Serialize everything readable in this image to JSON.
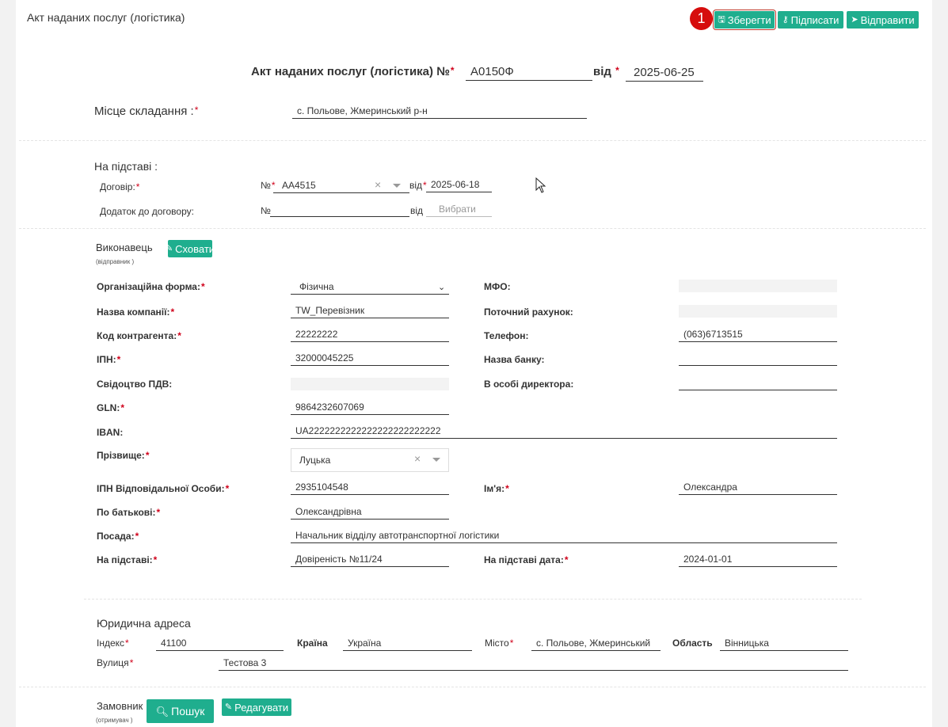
{
  "header": {
    "title": "Акт наданих послуг (логістика)",
    "step_badge": "1",
    "save_label": "Зберегти",
    "sign_label": "Підписати",
    "send_label": "Відправити"
  },
  "doc": {
    "title": "Акт наданих послуг (логістика) №",
    "number": "А0150Ф",
    "date_prefix": "від",
    "date": "2025-06-25"
  },
  "place": {
    "label": "Місце складання :",
    "value": "с. Польове, Жмеринський р-н"
  },
  "basis": {
    "heading": "На підставі :",
    "contract_label": "Договір:",
    "no_label": "№",
    "contract_number": "АА4515",
    "from_label": "від",
    "contract_date": "2025-06-18",
    "addendum_label": "Додаток до договору:",
    "addendum_number": "",
    "addendum_date_placeholder": "Вибрати"
  },
  "executor": {
    "heading": "Виконавець",
    "sub": "(відправник )",
    "hide_label": "Сховати",
    "org_form_label": "Організаційна форма:",
    "org_form": "Фізична",
    "company_label": "Назва компанії:",
    "company": "TW_Перевізник",
    "code_label": "Код контрагента:",
    "code": "22222222",
    "ipn_label": "ІПН:",
    "ipn": "32000045225",
    "vat_label": "Свідоцтво ПДВ:",
    "gln_label": "GLN:",
    "gln": "9864232607069",
    "iban_label": "IBAN:",
    "iban": "UA2222222222222222222222222",
    "surname_label": "Прізвище:",
    "surname": "Луцька",
    "resp_ipn_label": "ІПН Відповідальної Особи:",
    "resp_ipn": "2935104548",
    "patronymic_label": "По батькові:",
    "patronymic": "Олександрівна",
    "position_label": "Посада:",
    "position": "Начальник відділу автотранспортної логістики",
    "basis_label": "На підставі:",
    "basis": "Довіреність №11/24",
    "mfo_label": "МФО:",
    "account_label": "Поточний рахунок:",
    "phone_label": "Телефон:",
    "phone": "(063)6713515",
    "bank_label": "Назва банку:",
    "bank": "",
    "director_label": "В особі директора:",
    "director": "",
    "name_label": "Ім'я:",
    "name": "Олександра",
    "basis_date_label": "На підставі дата:",
    "basis_date": "2024-01-01"
  },
  "address": {
    "heading": "Юридична адреса",
    "index_label": "Індекс",
    "index": "41100",
    "country_label": "Країна",
    "country": "Україна",
    "city_label": "Місто",
    "city": "с. Польове, Жмеринський",
    "region_label": "Область",
    "region": "Вінницька",
    "street_label": "Вулиця",
    "street": "Тестова 3"
  },
  "customer": {
    "heading": "Замовник",
    "sub": "(отримувач )",
    "search_label": "Пошук",
    "edit_label": "Редагувати"
  },
  "colors": {
    "accent": "#1fae8e",
    "required": "#d0021b",
    "badge": "#d60d0d"
  }
}
